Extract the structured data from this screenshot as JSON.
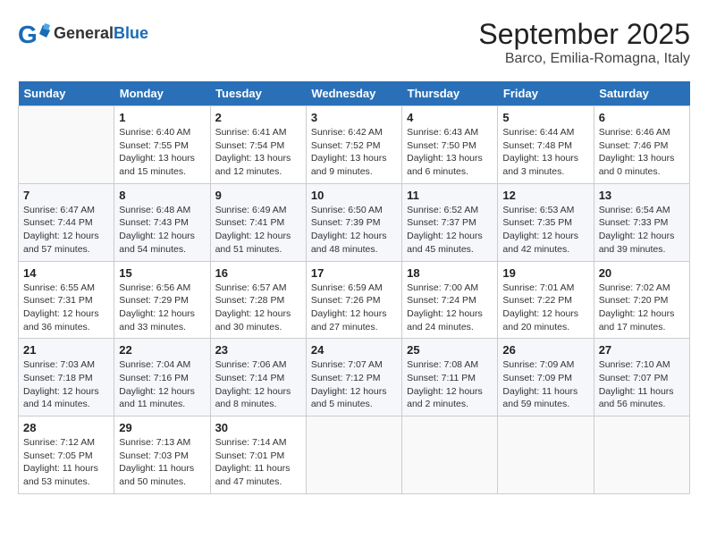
{
  "header": {
    "logo_general": "General",
    "logo_blue": "Blue",
    "month": "September 2025",
    "location": "Barco, Emilia-Romagna, Italy"
  },
  "weekdays": [
    "Sunday",
    "Monday",
    "Tuesday",
    "Wednesday",
    "Thursday",
    "Friday",
    "Saturday"
  ],
  "weeks": [
    [
      {
        "day": "",
        "info": ""
      },
      {
        "day": "1",
        "info": "Sunrise: 6:40 AM\nSunset: 7:55 PM\nDaylight: 13 hours\nand 15 minutes."
      },
      {
        "day": "2",
        "info": "Sunrise: 6:41 AM\nSunset: 7:54 PM\nDaylight: 13 hours\nand 12 minutes."
      },
      {
        "day": "3",
        "info": "Sunrise: 6:42 AM\nSunset: 7:52 PM\nDaylight: 13 hours\nand 9 minutes."
      },
      {
        "day": "4",
        "info": "Sunrise: 6:43 AM\nSunset: 7:50 PM\nDaylight: 13 hours\nand 6 minutes."
      },
      {
        "day": "5",
        "info": "Sunrise: 6:44 AM\nSunset: 7:48 PM\nDaylight: 13 hours\nand 3 minutes."
      },
      {
        "day": "6",
        "info": "Sunrise: 6:46 AM\nSunset: 7:46 PM\nDaylight: 13 hours\nand 0 minutes."
      }
    ],
    [
      {
        "day": "7",
        "info": "Sunrise: 6:47 AM\nSunset: 7:44 PM\nDaylight: 12 hours\nand 57 minutes."
      },
      {
        "day": "8",
        "info": "Sunrise: 6:48 AM\nSunset: 7:43 PM\nDaylight: 12 hours\nand 54 minutes."
      },
      {
        "day": "9",
        "info": "Sunrise: 6:49 AM\nSunset: 7:41 PM\nDaylight: 12 hours\nand 51 minutes."
      },
      {
        "day": "10",
        "info": "Sunrise: 6:50 AM\nSunset: 7:39 PM\nDaylight: 12 hours\nand 48 minutes."
      },
      {
        "day": "11",
        "info": "Sunrise: 6:52 AM\nSunset: 7:37 PM\nDaylight: 12 hours\nand 45 minutes."
      },
      {
        "day": "12",
        "info": "Sunrise: 6:53 AM\nSunset: 7:35 PM\nDaylight: 12 hours\nand 42 minutes."
      },
      {
        "day": "13",
        "info": "Sunrise: 6:54 AM\nSunset: 7:33 PM\nDaylight: 12 hours\nand 39 minutes."
      }
    ],
    [
      {
        "day": "14",
        "info": "Sunrise: 6:55 AM\nSunset: 7:31 PM\nDaylight: 12 hours\nand 36 minutes."
      },
      {
        "day": "15",
        "info": "Sunrise: 6:56 AM\nSunset: 7:29 PM\nDaylight: 12 hours\nand 33 minutes."
      },
      {
        "day": "16",
        "info": "Sunrise: 6:57 AM\nSunset: 7:28 PM\nDaylight: 12 hours\nand 30 minutes."
      },
      {
        "day": "17",
        "info": "Sunrise: 6:59 AM\nSunset: 7:26 PM\nDaylight: 12 hours\nand 27 minutes."
      },
      {
        "day": "18",
        "info": "Sunrise: 7:00 AM\nSunset: 7:24 PM\nDaylight: 12 hours\nand 24 minutes."
      },
      {
        "day": "19",
        "info": "Sunrise: 7:01 AM\nSunset: 7:22 PM\nDaylight: 12 hours\nand 20 minutes."
      },
      {
        "day": "20",
        "info": "Sunrise: 7:02 AM\nSunset: 7:20 PM\nDaylight: 12 hours\nand 17 minutes."
      }
    ],
    [
      {
        "day": "21",
        "info": "Sunrise: 7:03 AM\nSunset: 7:18 PM\nDaylight: 12 hours\nand 14 minutes."
      },
      {
        "day": "22",
        "info": "Sunrise: 7:04 AM\nSunset: 7:16 PM\nDaylight: 12 hours\nand 11 minutes."
      },
      {
        "day": "23",
        "info": "Sunrise: 7:06 AM\nSunset: 7:14 PM\nDaylight: 12 hours\nand 8 minutes."
      },
      {
        "day": "24",
        "info": "Sunrise: 7:07 AM\nSunset: 7:12 PM\nDaylight: 12 hours\nand 5 minutes."
      },
      {
        "day": "25",
        "info": "Sunrise: 7:08 AM\nSunset: 7:11 PM\nDaylight: 12 hours\nand 2 minutes."
      },
      {
        "day": "26",
        "info": "Sunrise: 7:09 AM\nSunset: 7:09 PM\nDaylight: 11 hours\nand 59 minutes."
      },
      {
        "day": "27",
        "info": "Sunrise: 7:10 AM\nSunset: 7:07 PM\nDaylight: 11 hours\nand 56 minutes."
      }
    ],
    [
      {
        "day": "28",
        "info": "Sunrise: 7:12 AM\nSunset: 7:05 PM\nDaylight: 11 hours\nand 53 minutes."
      },
      {
        "day": "29",
        "info": "Sunrise: 7:13 AM\nSunset: 7:03 PM\nDaylight: 11 hours\nand 50 minutes."
      },
      {
        "day": "30",
        "info": "Sunrise: 7:14 AM\nSunset: 7:01 PM\nDaylight: 11 hours\nand 47 minutes."
      },
      {
        "day": "",
        "info": ""
      },
      {
        "day": "",
        "info": ""
      },
      {
        "day": "",
        "info": ""
      },
      {
        "day": "",
        "info": ""
      }
    ]
  ]
}
